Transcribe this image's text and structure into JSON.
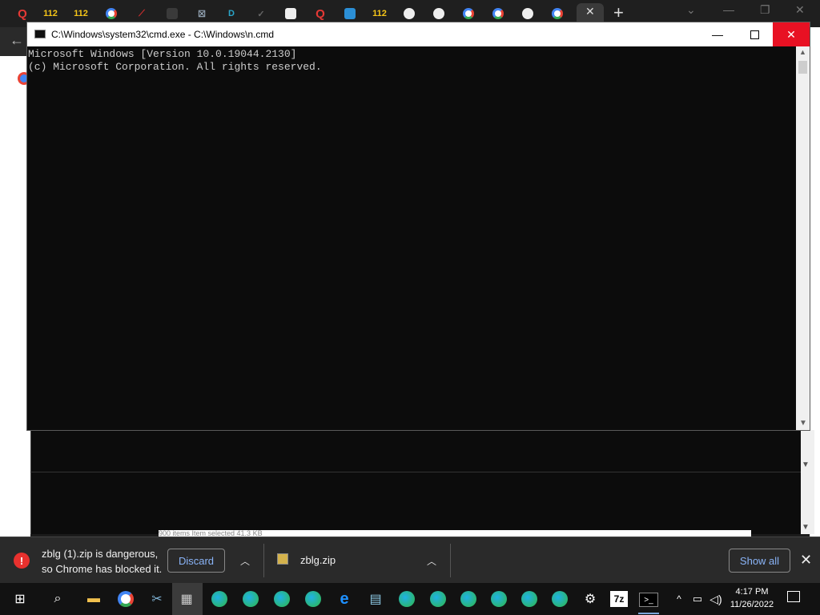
{
  "cmd_window": {
    "title": "C:\\Windows\\system32\\cmd.exe - C:\\Windows\\n.cmd",
    "lines": [
      "Microsoft Windows [Version 10.0.19044.2130]",
      "(c) Microsoft Corporation. All rights reserved."
    ]
  },
  "chrome": {
    "tab_labels": [
      "112",
      "112",
      "112"
    ],
    "active_tab_close": "✕",
    "new_tab": "+"
  },
  "explorer": {
    "status": "900 items    Item selected  41.3 KB"
  },
  "download_bar": {
    "danger_message": "zblg (1).zip is dangerous, so Chrome has blocked it.",
    "discard_label": "Discard",
    "file_name": "zblg.zip",
    "show_all_label": "Show all"
  },
  "taskbar": {
    "seven_zip": "7z",
    "time": "4:17 PM",
    "date": "11/26/2022"
  },
  "colors": {
    "console_bg": "#0c0c0c",
    "console_text": "#cccccc",
    "close_red": "#e81123",
    "link_blue": "#8ab4f8"
  }
}
